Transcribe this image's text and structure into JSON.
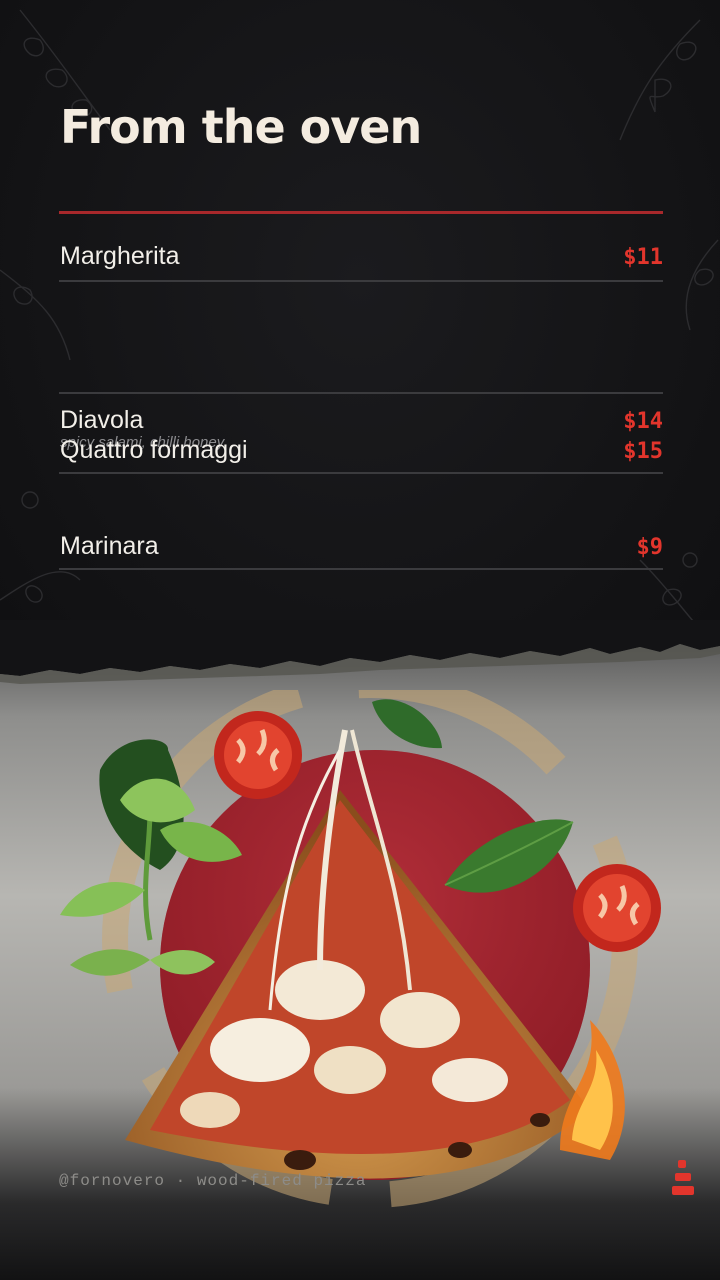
{
  "title": "From the oven",
  "colors": {
    "background": "#141416",
    "accent": "#a8282b",
    "price": "#e2352c",
    "text": "#f2efe9"
  },
  "menu": {
    "items": [
      {
        "name": "Margherita",
        "description": "",
        "price": "$11"
      },
      {
        "name": "Diavola",
        "description": "spicy salami, chilli honey",
        "price": "$14"
      },
      {
        "name": "Quattro formaggi",
        "description": "",
        "price": "$15"
      },
      {
        "name": "Marinara",
        "description": "",
        "price": "$9"
      }
    ]
  },
  "footer": {
    "handle": "@fornovero · wood-fired pizza"
  },
  "icons": {
    "brand": "stacked-bars-logo-icon"
  }
}
